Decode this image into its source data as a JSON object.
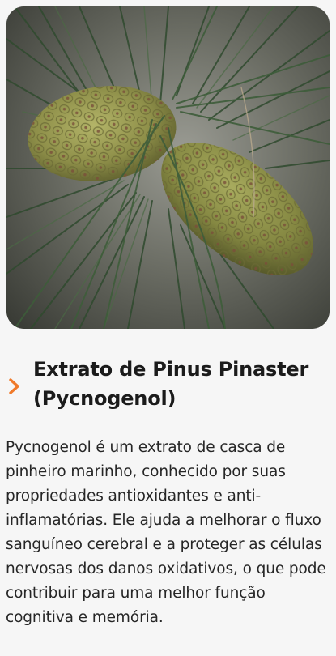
{
  "image": {
    "subject": "pine-cones-photo"
  },
  "section": {
    "title": "Extrato de Pinus Pinaster (Pycnogenol)",
    "description": "Pycnogenol é um extrato de casca de pinheiro marinho, conhecido por suas propriedades antioxidantes e anti-inflamatórias. Ele ajuda a melhorar o fluxo sanguíneo cerebral e a proteger as células nervosas dos danos oxidativos, o que pode contribuir para uma melhor função cognitiva e memória."
  },
  "icons": {
    "expand": "chevron-right-icon"
  },
  "colors": {
    "accent": "#f07a2a",
    "text": "#1b1b1b",
    "background": "#f6f6f6"
  }
}
